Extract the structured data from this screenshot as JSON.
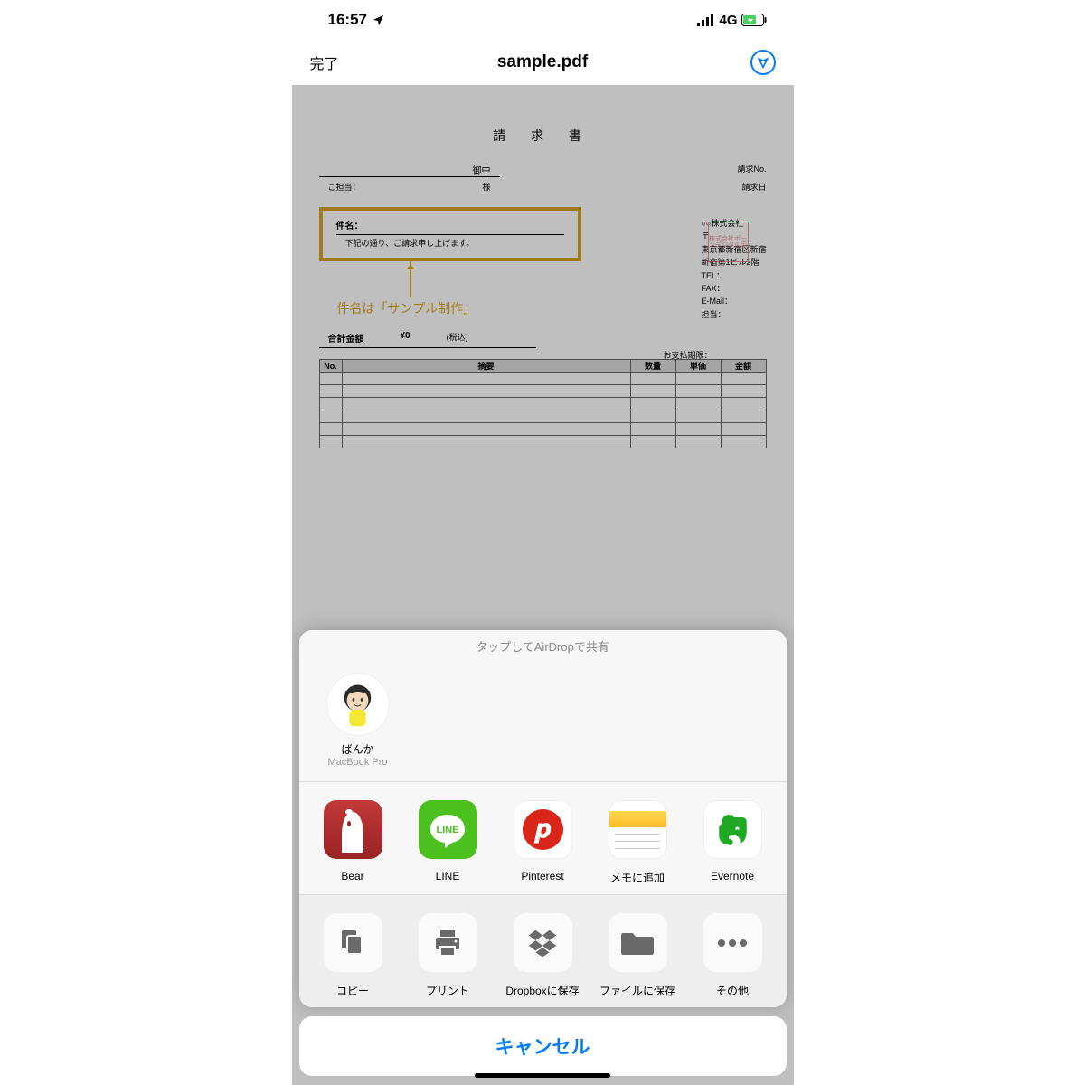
{
  "status": {
    "time": "16:57",
    "network": "4G"
  },
  "nav": {
    "done": "完了",
    "title": "sample.pdf"
  },
  "pdf": {
    "title": "請 求 書",
    "onchu": "御中",
    "req_no_label": "請求No.",
    "req_date_label": "請求日",
    "tanto_label": "ご担当：",
    "tanto_suffix": "様",
    "subject_label": "件名：",
    "subject_note": "下記の通り、ご請求申し上げます。",
    "annotation": "件名は「サンプル制作」",
    "company": "○○株式会社",
    "zip": "〒",
    "addr1": "東京都新宿区新宿",
    "addr2": "新宿第1ビル2階",
    "tel": "TEL：",
    "fax": "FAX：",
    "email": "E-Mail：",
    "contact": "担当：",
    "stamp": "株式会社ボーンデジタル印",
    "total_label": "合計金額",
    "total_value": "¥0",
    "tax_label": "(税込)",
    "due_label": "お支払期限：",
    "th_no": "No.",
    "th_desc": "摘要",
    "th_qty": "数量",
    "th_price": "単価",
    "th_amount": "金額"
  },
  "share": {
    "airdrop_header": "タップしてAirDropで共有",
    "airdrop": {
      "name": "ばんか",
      "device": "MacBook Pro"
    },
    "apps": [
      {
        "label": "Bear"
      },
      {
        "label": "LINE"
      },
      {
        "label": "Pinterest"
      },
      {
        "label": "メモに追加"
      },
      {
        "label": "Evernote"
      }
    ],
    "actions": [
      {
        "label": "コピー"
      },
      {
        "label": "プリント"
      },
      {
        "label": "Dropboxに保存"
      },
      {
        "label": "ファイルに保存"
      },
      {
        "label": "その他"
      }
    ],
    "cancel": "キャンセル"
  }
}
